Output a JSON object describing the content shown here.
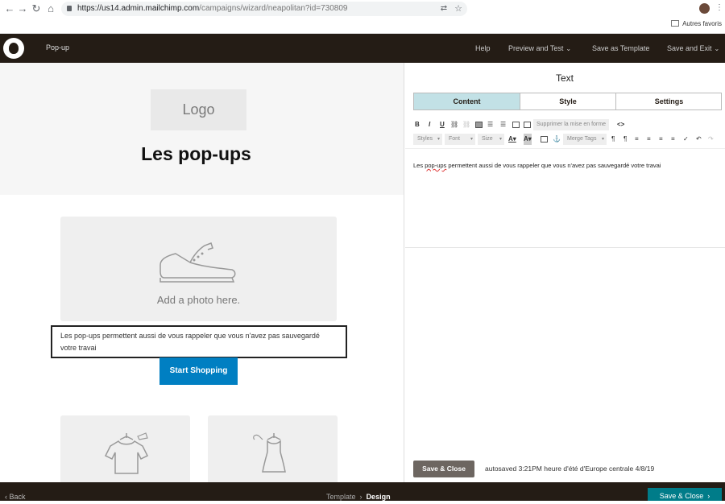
{
  "browser": {
    "url_host": "https://us14.admin.mailchimp.com",
    "url_path": "/campaigns/wizard/neapolitan?id=730809",
    "bookmarks_label": "Autres favoris"
  },
  "header": {
    "title": "Pop-up",
    "help": "Help",
    "preview": "Preview and Test",
    "save_template": "Save as Template",
    "save_exit": "Save and Exit"
  },
  "design": {
    "logo_placeholder": "Logo",
    "headline": "Les pop-ups",
    "photo_placeholder": "Add a photo here.",
    "body_text": "Les pop-ups permettent aussi de vous rappeler que vous n'avez pas sauvegardé votre travai",
    "cta_label": "Start Shopping"
  },
  "editor": {
    "title": "Text",
    "tabs": [
      {
        "label": "Content",
        "active": true
      },
      {
        "label": "Style",
        "active": false
      },
      {
        "label": "Settings",
        "active": false
      }
    ],
    "toolbar": {
      "bold": "B",
      "italic": "I",
      "underline": "U",
      "remove_format": "Supprimer la mise en forme",
      "source": "<>",
      "styles": "Styles",
      "font": "Font",
      "size": "Size",
      "merge_tags": "Merge Tags"
    },
    "content_text_pre": "Les ",
    "content_text_spell": "pop-ups",
    "content_text_post": " permettent aussi de vous rappeler que vous n'avez pas sauvegardé votre travai",
    "save_close": "Save & Close",
    "autosaved": "autosaved 3:21PM heure d'été d'Europe centrale 4/8/19"
  },
  "footer": {
    "back": "Back",
    "crumb_template": "Template",
    "crumb_design": "Design",
    "save_close": "Save & Close"
  },
  "colors": {
    "brand_dark": "#241c15",
    "cta_blue": "#007fc2",
    "teal": "#007c89",
    "tab_active": "#c2e1e6"
  }
}
